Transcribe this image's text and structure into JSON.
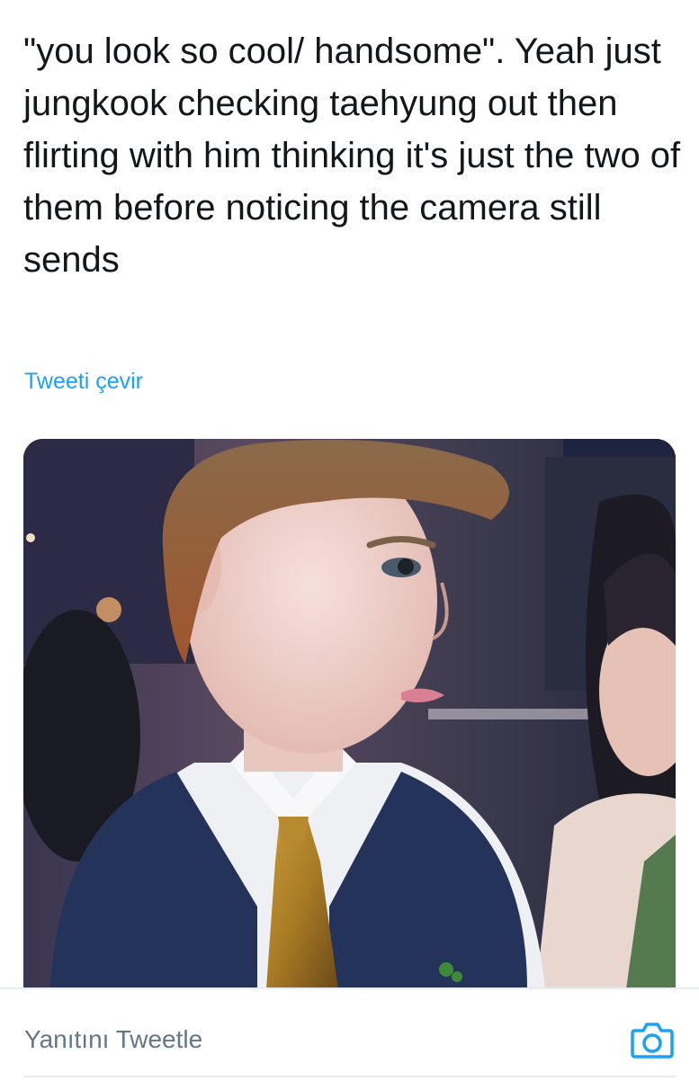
{
  "tweet": {
    "text": "\"you look so cool/ handsome\". Yeah just jungkook checking taehyung out then flirting with him thinking it's just the two of them before noticing the camera still sends",
    "translate_label": "Tweeti çevir"
  },
  "reply": {
    "placeholder": "Yanıtını Tweetle"
  },
  "icons": {
    "camera": "camera-icon"
  },
  "colors": {
    "text": "#14171a",
    "link": "#1da1f2",
    "muted": "#657786",
    "border": "#e6ecf0"
  }
}
